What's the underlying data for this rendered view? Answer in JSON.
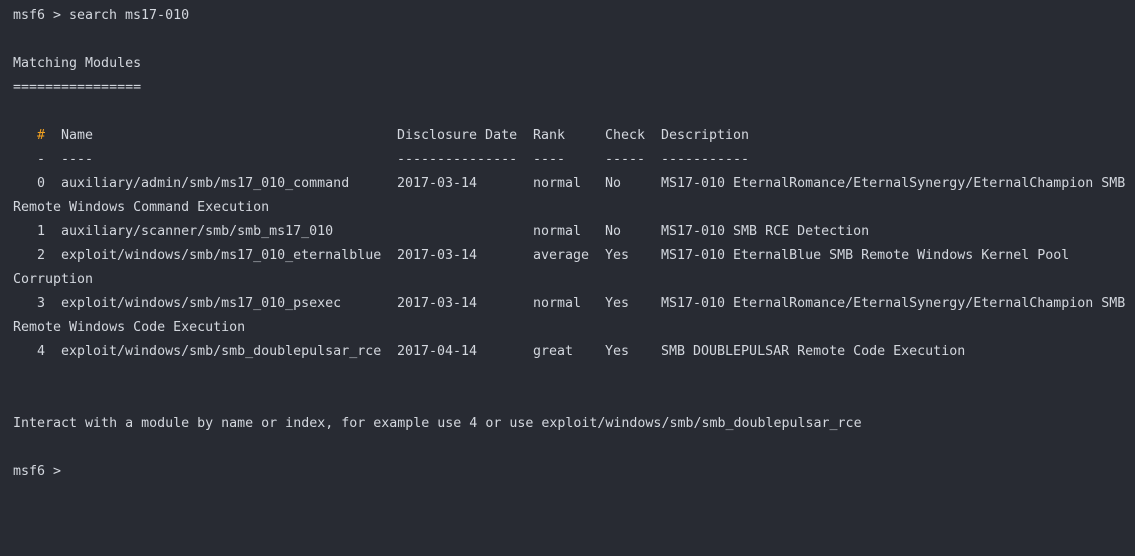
{
  "prompt": "msf6 >",
  "command": "search ms17-010",
  "heading": "Matching Modules",
  "heading_underline": "================",
  "columns": {
    "num": "#",
    "name": "Name",
    "date": "Disclosure Date",
    "rank": "Rank",
    "check": "Check",
    "desc": "Description"
  },
  "separators": {
    "num": "-",
    "name": "----",
    "date": "---------------",
    "rank": "----",
    "check": "-----",
    "desc": "-----------"
  },
  "rows": [
    {
      "num": "0",
      "name": "auxiliary/admin/smb/ms17_010_command",
      "date": "2017-03-14",
      "rank": "normal",
      "check": "No",
      "desc": "MS17-010 EternalRomance/EternalSynergy/EternalChampion SMB",
      "wrap": "Remote Windows Command Execution"
    },
    {
      "num": "1",
      "name": "auxiliary/scanner/smb/smb_ms17_010",
      "date": "",
      "rank": "normal",
      "check": "No",
      "desc": "MS17-010 SMB RCE Detection",
      "wrap": ""
    },
    {
      "num": "2",
      "name": "exploit/windows/smb/ms17_010_eternalblue",
      "date": "2017-03-14",
      "rank": "average",
      "check": "Yes",
      "desc": "MS17-010 EternalBlue SMB Remote Windows Kernel Pool",
      "wrap": "Corruption"
    },
    {
      "num": "3",
      "name": "exploit/windows/smb/ms17_010_psexec",
      "date": "2017-03-14",
      "rank": "normal",
      "check": "Yes",
      "desc": "MS17-010 EternalRomance/EternalSynergy/EternalChampion SMB",
      "wrap": "Remote Windows Code Execution"
    },
    {
      "num": "4",
      "name": "exploit/windows/smb/smb_doublepulsar_rce",
      "date": "2017-04-14",
      "rank": "great",
      "check": "Yes",
      "desc": "SMB DOUBLEPULSAR Remote Code Execution",
      "wrap": ""
    }
  ],
  "footer": "Interact with a module by name or index, for example use 4 or use exploit/windows/smb/smb_doublepulsar_rce",
  "final_prompt": "msf6 >",
  "colors": {
    "background": "#282b33",
    "text": "#d3d7de",
    "hash_accent": "#f0a020"
  }
}
